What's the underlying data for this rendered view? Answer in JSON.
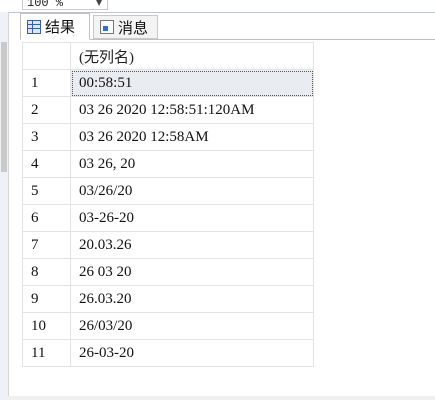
{
  "toolbar": {
    "zoom_value": "100 %"
  },
  "tabs": [
    {
      "label": "结果",
      "icon": "grid-icon",
      "active": true
    },
    {
      "label": "消息",
      "icon": "message-icon",
      "active": false
    }
  ],
  "grid": {
    "column_header": "(无列名)",
    "rows": [
      {
        "n": "1",
        "value": "00:58:51"
      },
      {
        "n": "2",
        "value": "03 26 2020 12:58:51:120AM"
      },
      {
        "n": "3",
        "value": "03 26 2020 12:58AM"
      },
      {
        "n": "4",
        "value": "03 26, 20"
      },
      {
        "n": "5",
        "value": "03/26/20"
      },
      {
        "n": "6",
        "value": "03-26-20"
      },
      {
        "n": "7",
        "value": "20.03.26"
      },
      {
        "n": "8",
        "value": "26 03 20"
      },
      {
        "n": "9",
        "value": "26.03.20"
      },
      {
        "n": "10",
        "value": "26/03/20"
      },
      {
        "n": "11",
        "value": "26-03-20"
      }
    ]
  }
}
